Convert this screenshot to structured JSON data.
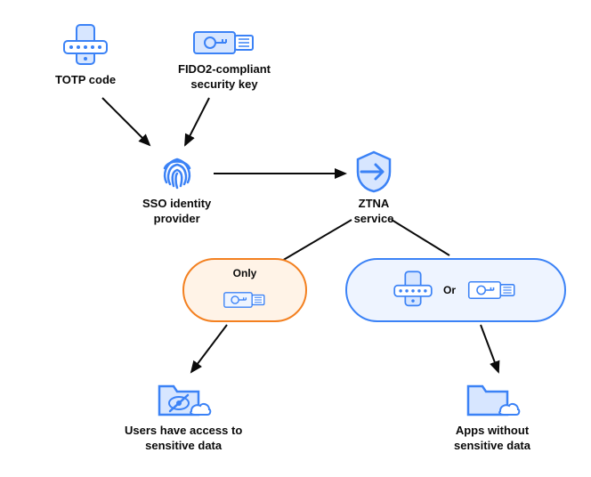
{
  "nodes": {
    "totp": {
      "label": "TOTP code"
    },
    "fido2": {
      "label": "FIDO2-compliant\nsecurity key"
    },
    "sso": {
      "label": "SSO identity\nprovider"
    },
    "ztna": {
      "label": "ZTNA\nservice"
    },
    "sensitive": {
      "label": "Users have access to\nsensitive data"
    },
    "apps": {
      "label": "Apps without\nsensitive data"
    }
  },
  "pills": {
    "only": {
      "label": "Only"
    },
    "or": {
      "label": "Or"
    }
  },
  "colors": {
    "blue": "#3b82f6",
    "blueLight": "#93c5fd",
    "orange": "#f38020",
    "orangeLight": "#fff3e7",
    "black": "#0a0a0a"
  },
  "chart_data": {
    "type": "diagram",
    "title": "",
    "nodes": [
      {
        "id": "totp",
        "label": "TOTP code",
        "icon": "smartphone-otp"
      },
      {
        "id": "fido2",
        "label": "FIDO2-compliant security key",
        "icon": "security-key"
      },
      {
        "id": "sso",
        "label": "SSO identity provider",
        "icon": "fingerprint"
      },
      {
        "id": "ztna",
        "label": "ZTNA service",
        "icon": "shield-arrow"
      },
      {
        "id": "only",
        "label": "Only",
        "type": "condition",
        "requires": [
          "fido2"
        ],
        "color": "orange"
      },
      {
        "id": "or",
        "label": "Or",
        "type": "condition",
        "requires_any": [
          "totp",
          "fido2"
        ],
        "color": "blue"
      },
      {
        "id": "sensitive",
        "label": "Users have access to sensitive data",
        "icon": "folder-hidden-cloud"
      },
      {
        "id": "apps",
        "label": "Apps without sensitive data",
        "icon": "folder-cloud"
      }
    ],
    "edges": [
      {
        "from": "totp",
        "to": "sso"
      },
      {
        "from": "fido2",
        "to": "sso"
      },
      {
        "from": "sso",
        "to": "ztna"
      },
      {
        "from": "ztna",
        "to": "only"
      },
      {
        "from": "ztna",
        "to": "or"
      },
      {
        "from": "only",
        "to": "sensitive"
      },
      {
        "from": "or",
        "to": "apps"
      }
    ]
  }
}
